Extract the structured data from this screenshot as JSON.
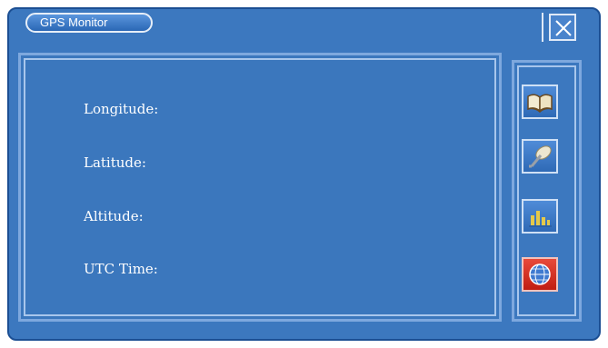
{
  "window": {
    "title": "GPS Monitor"
  },
  "fields": [
    {
      "label": "Longitude:"
    },
    {
      "label": "Latitude:"
    },
    {
      "label": "Altitude:"
    },
    {
      "label": "UTC Time:"
    }
  ],
  "toolbar": {
    "buttons": [
      {
        "icon": "book-icon"
      },
      {
        "icon": "satellite-dish-icon"
      },
      {
        "icon": "bar-chart-icon"
      },
      {
        "icon": "globe-icon"
      }
    ]
  },
  "colors": {
    "background": "#3c78bf",
    "frame": "#7ea8de",
    "active_button": "#d42a1f"
  }
}
